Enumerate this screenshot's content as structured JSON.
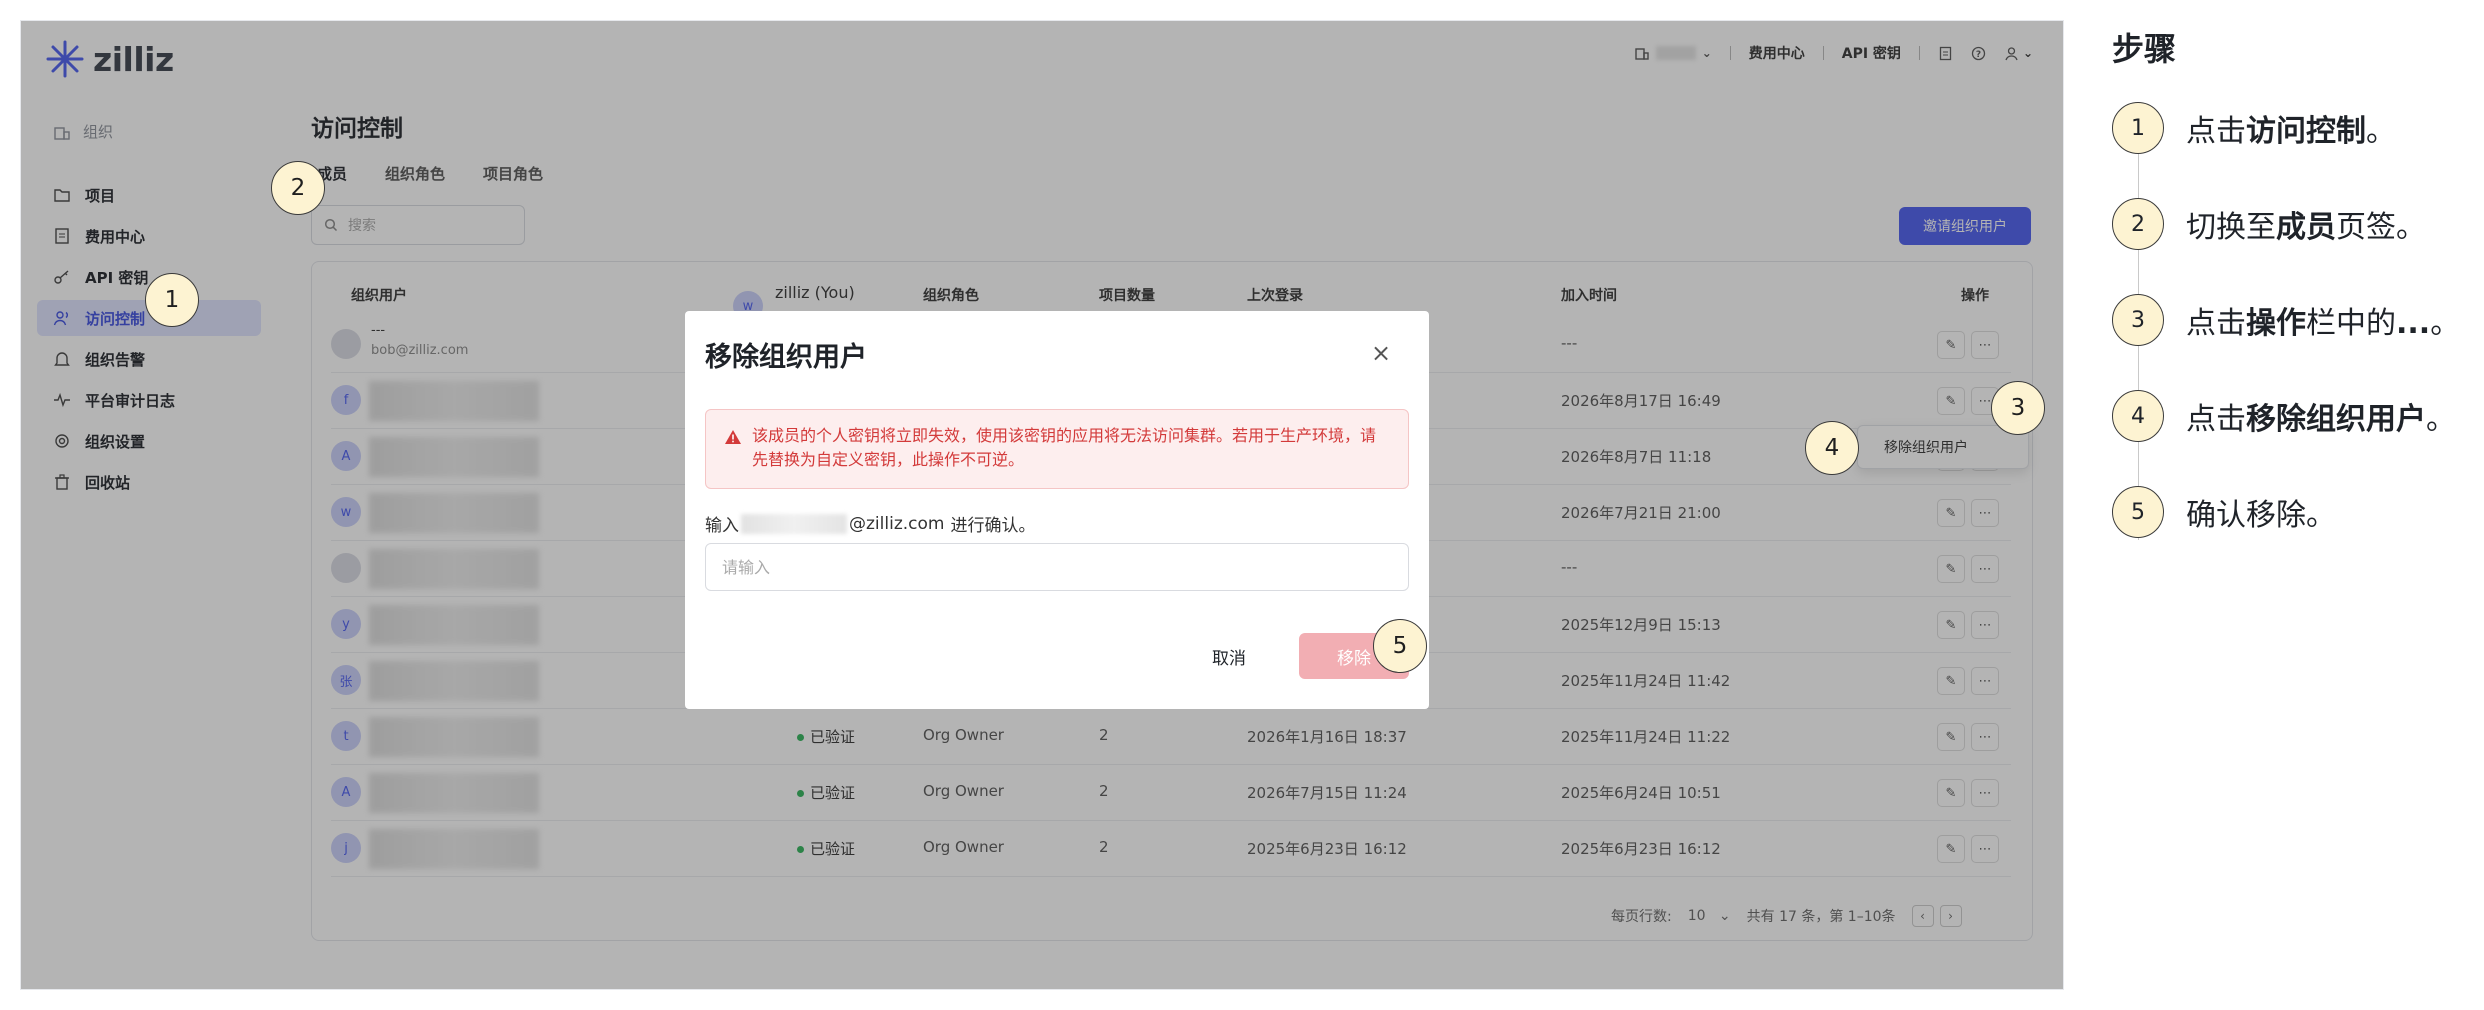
{
  "app": {
    "logo_text": "zilliz",
    "top_nav": {
      "billing": "费用中心",
      "api_keys": "API 密钥"
    }
  },
  "sidebar": {
    "org_label": "组织",
    "items": [
      {
        "label": "项目",
        "icon": "folder-icon"
      },
      {
        "label": "费用中心",
        "icon": "receipt-icon"
      },
      {
        "label": "API 密钥",
        "icon": "key-icon"
      },
      {
        "label": "访问控制",
        "icon": "users-icon",
        "active": true
      },
      {
        "label": "组织告警",
        "icon": "bell-icon"
      },
      {
        "label": "平台审计日志",
        "icon": "activity-icon"
      },
      {
        "label": "组织设置",
        "icon": "settings-icon"
      },
      {
        "label": "回收站",
        "icon": "trash-icon"
      }
    ]
  },
  "main": {
    "title": "访问控制",
    "tabs": [
      "成员",
      "组织角色",
      "项目角色"
    ],
    "search_placeholder": "搜索",
    "invite_button": "邀请组织用户",
    "columns": [
      "组织用户",
      "组织角色",
      "项目数量",
      "上次登录",
      "加入时间",
      "操作"
    ],
    "you_user": {
      "name": "zilliz (You)",
      "avatar": "w"
    },
    "rows": [
      {
        "avatar": "",
        "name": "---",
        "email": "bob@zilliz.com",
        "status": "",
        "role": "",
        "projects": "",
        "last_login": "",
        "joined": "---"
      },
      {
        "avatar": "f",
        "name": "",
        "email": "",
        "status": "",
        "role": "",
        "projects": "",
        "last_login": "",
        "joined": "2026年8月17日 16:49"
      },
      {
        "avatar": "A",
        "name": "",
        "email": "",
        "status": "",
        "role": "",
        "projects": "",
        "last_login": "",
        "joined": "2026年8月7日 11:18"
      },
      {
        "avatar": "w",
        "name": "",
        "email": "",
        "status": "",
        "role": "",
        "projects": "",
        "last_login": "",
        "joined": "2026年7月21日 21:00"
      },
      {
        "avatar": "",
        "name": "",
        "email": "",
        "status": "",
        "role": "",
        "projects": "",
        "last_login": "",
        "joined": "---"
      },
      {
        "avatar": "y",
        "name": "",
        "email": "",
        "status": "",
        "role": "",
        "projects": "",
        "last_login": "",
        "joined": "2025年12月9日 15:13"
      },
      {
        "avatar": "张",
        "name": "",
        "email": "",
        "status": "",
        "role": "",
        "projects": "",
        "last_login": "",
        "joined": "2025年11月24日 11:42"
      },
      {
        "avatar": "t",
        "name": "",
        "email": "",
        "status": "已验证",
        "role": "Org Owner",
        "projects": "2",
        "last_login": "2026年1月16日 18:37",
        "joined": "2025年11月24日 11:22"
      },
      {
        "avatar": "A",
        "name": "",
        "email": "",
        "status": "已验证",
        "role": "Org Owner",
        "projects": "2",
        "last_login": "2026年7月15日 11:24",
        "joined": "2025年6月24日 10:51"
      },
      {
        "avatar": "j",
        "name": "",
        "email": "",
        "status": "已验证",
        "role": "Org Owner",
        "projects": "2",
        "last_login": "2025年6月23日 16:12",
        "joined": "2025年6月23日 16:12"
      }
    ],
    "pager": {
      "per_page_label": "每页行数:",
      "per_page_value": "10",
      "summary": "共有 17 条，第 1–10条"
    },
    "row_menu": {
      "remove": "移除组织用户"
    }
  },
  "modal": {
    "title": "移除组织用户",
    "warning": "该成员的个人密钥将立即失效，使用该密钥的应用将无法访问集群。若用于生产环境，请先替换为自定义密钥，此操作不可逆。",
    "confirm_prefix": "输入",
    "confirm_email": "@zilliz.com",
    "confirm_suffix": "进行确认。",
    "input_placeholder": "请输入",
    "cancel": "取消",
    "remove": "移除"
  },
  "callouts": [
    "1",
    "2",
    "3",
    "4",
    "5"
  ],
  "steps_panel": {
    "title": "步骤",
    "steps": [
      {
        "num": "1",
        "pre": "点击",
        "bold": "访问控制",
        "post": "。"
      },
      {
        "num": "2",
        "pre": "切换至",
        "bold": "成员",
        "post": "页签。"
      },
      {
        "num": "3",
        "pre": "点击",
        "bold": "操作",
        "post": "栏中的",
        "bold2": "...",
        "post2": "。"
      },
      {
        "num": "4",
        "pre": "点击",
        "bold": "移除组织用户",
        "post": "。"
      },
      {
        "num": "5",
        "pre": "确认移除。",
        "bold": "",
        "post": ""
      }
    ]
  },
  "colors": {
    "accent": "#4b5cf0",
    "danger": "#d33a3a",
    "callout": "#fdf3d2"
  }
}
